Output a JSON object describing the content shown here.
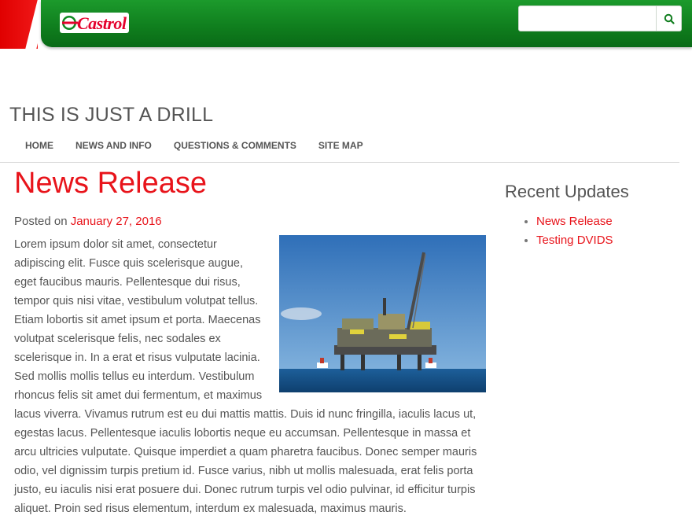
{
  "header": {
    "logo_text": "Castrol",
    "search": {
      "placeholder": "",
      "value": ""
    },
    "colors": {
      "brand_green": "#0f7d1d",
      "brand_red": "#e4002b"
    }
  },
  "site": {
    "title": "THIS IS JUST A DRILL"
  },
  "nav": {
    "items": [
      {
        "label": "HOME"
      },
      {
        "label": "NEWS AND INFO"
      },
      {
        "label": "QUESTIONS & COMMENTS"
      },
      {
        "label": "SITE MAP"
      }
    ]
  },
  "post": {
    "title": "News Release",
    "posted_prefix": "Posted on ",
    "date": "January 27, 2016",
    "body": "Lorem ipsum dolor sit amet, consectetur adipiscing elit. Fusce quis scelerisque augue, eget faucibus mauris. Pellentesque dui risus, tempor quis nisi vitae, vestibulum volutpat tellus. Etiam lobortis sit amet ipsum et porta. Maecenas volutpat scelerisque felis, nec sodales ex scelerisque in. In a erat et risus vulputate lacinia. Sed mollis mollis tellus eu interdum. Vestibulum rhoncus felis sit amet dui fermentum, et maximus lacus viverra. Vivamus rutrum est eu dui mattis mattis. Duis id nunc fringilla, iaculis lacus ut, egestas lacus. Pellentesque iaculis lobortis neque eu accumsan. Pellentesque in massa et arcu ultricies vulputate. Quisque imperdiet a quam pharetra faucibus. Donec semper mauris odio, vel dignissim turpis pretium id. Fusce varius, nibh ut mollis malesuada, erat felis porta justo, eu iaculis nisi erat posuere dui. Donec rutrum turpis vel odio pulvinar, id efficitur turpis aliquet. Proin sed risus elementum, interdum ex malesuada, maximus mauris."
  },
  "sidebar": {
    "widget_title": "Recent Updates",
    "items": [
      {
        "label": "News Release"
      },
      {
        "label": "Testing DVIDS"
      }
    ]
  }
}
